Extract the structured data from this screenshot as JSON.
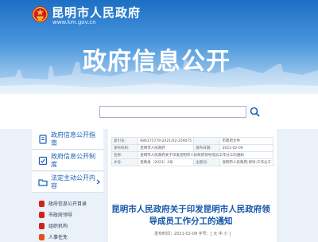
{
  "header": {
    "site_name": "昆明市人民政府",
    "site_url": "www.km.gov.cn",
    "page_title": "政府信息公开"
  },
  "search": {
    "placeholder": ""
  },
  "sidebar": {
    "items": [
      {
        "label": "政府信息公开指南"
      },
      {
        "label": "政府信息公开制度"
      },
      {
        "label": "法定主动公开内容"
      }
    ],
    "sub_items": [
      {
        "label": "政府信息公开目录"
      },
      {
        "label": "市政府领导"
      },
      {
        "label": "组织机构"
      },
      {
        "label": "人事任免"
      }
    ]
  },
  "doc_meta_table": {
    "rows": [
      {
        "k1": "索引号:",
        "v1": "686175779-2021/02-259075",
        "k2": "",
        "v2": "市政府文件"
      },
      {
        "k1": "发布机构:",
        "v1": "昆明市人民政府",
        "k2": "发布日期:",
        "v2": "2021-02-09"
      },
      {
        "k1": "名称:",
        "v1": "昆明市人民政府关于印发昆明市人民政府领导成员工作分工的通知",
        "k2": "",
        "v2": ""
      },
      {
        "k1": "文号:",
        "v1": "昆政发〔2021〕4号",
        "k2": "主题词:",
        "v2": "昆明市人民政府;领导;工作分工"
      }
    ]
  },
  "document": {
    "title": "昆明市人民政府关于印发昆明市人民政府领导成员工作分工的通知",
    "meta_line": "发布时间：2021-02-09 字号：[ 大 中 小 ]"
  },
  "colors": {
    "banner_top": "#1d6fc4",
    "link_blue": "#1a5fb4",
    "title_blue": "#1656a8",
    "emblem_red": "#d0211c",
    "emblem_gold": "#f4c430"
  }
}
